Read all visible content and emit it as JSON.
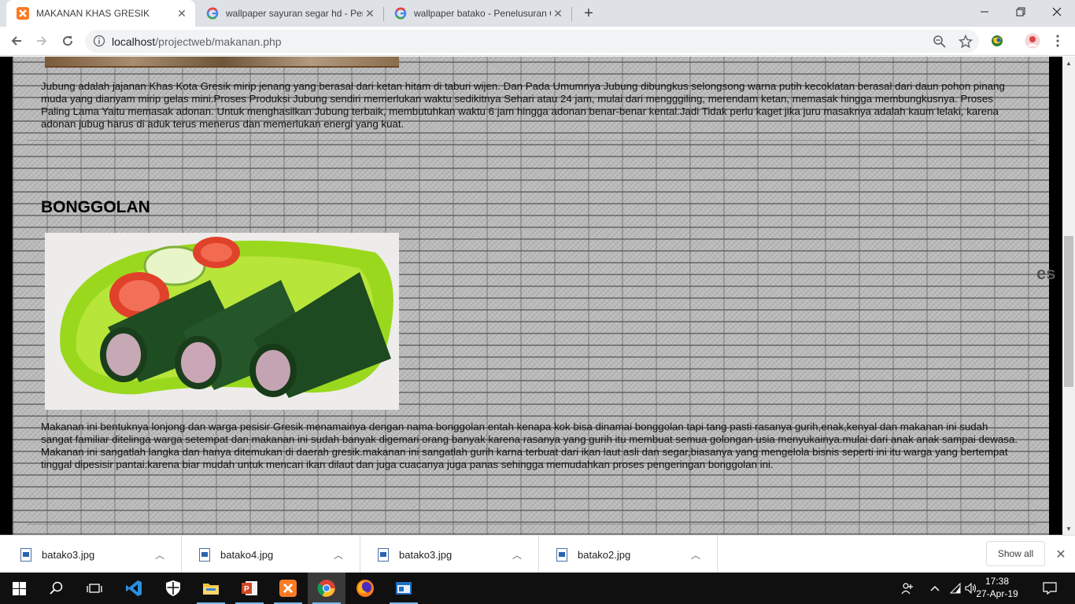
{
  "browser": {
    "tabs": [
      {
        "title": "MAKANAN KHAS GRESIK",
        "favicon": "xampp-icon",
        "active": true
      },
      {
        "title": "wallpaper sayuran segar hd - Pen",
        "favicon": "google-icon",
        "active": false
      },
      {
        "title": "wallpaper batako - Penelusuran G",
        "favicon": "google-icon",
        "active": false
      }
    ],
    "url_host": "localhost",
    "url_path": "/projectweb/makanan.php"
  },
  "page": {
    "jubung_paragraph": "Jubung adalah jajanan Khas Kota Gresik mirip jenang yang berasal dari ketan hitam di taburi wijen. Dan Pada Umumnya Jubung dibungkus selongsong warna putih kecoklatan berasal dari daun pohon pinang muda yang dianyam mirip gelas mini.Proses Produksi Jubung sendiri memerlukan waktu sedikitnya Sehari atau 24 jam, mulai dari mengggiling, merendam ketan, memasak hingga membungkusnya. Proses Paling Lama Yaitu memasak adonan. Untuk menghasilkan Jubung terbaik, membutuhkan waktu 6 jam hingga adonan benar-benar kental.Jadi Tidak perlu kaget jika juru masaknya adalah kaum lelaki, karena adonan jubug harus di aduk terus menerus dan memerlukan energi yang kuat.",
    "bonggolan_heading": "BONGGOLAN",
    "bonggolan_paragraph": "Makanan ini bentuknya lonjong dan warga pesisir Gresik menamainya dengan nama bonggolan entah kenapa kok bisa dinamai bonggolan tapi tang pasti rasanya gurih,enak,kenyal dan makanan ini sudah sangat familiar ditelinga warga setempat dan makanan ini sudah banyak digemari orang banyak karena rasanya yang gurih itu membuat semua golongan usia menyukainya.mulai dari anak anak sampai dewasa. Makanan ini sangatlah langka dan hanya ditemukan di daerah gresik.makanan ini sangatlah gurih karna terbuat dari ikan laut asli dan segar,biasanya yang mengelola bisnis seperti ini itu warga yang bertempat tinggal dipesisir pantai.karena biar mudah untuk mencari ikan dilaut dan juga cuacanya juga panas sehingga memudahkan proses pengeringan bonggolan ini.",
    "side_fragment": "es"
  },
  "downloads": {
    "items": [
      {
        "name": "batako3.jpg"
      },
      {
        "name": "batako4.jpg"
      },
      {
        "name": "batako3.jpg"
      },
      {
        "name": "batako2.jpg"
      }
    ],
    "show_all": "Show all"
  },
  "taskbar": {
    "time": "17:38",
    "date": "27-Apr-19"
  },
  "colors": {
    "brick": "#b9b9b9",
    "accent": "#76b9ed",
    "tab_bar": "#dee1e6"
  }
}
